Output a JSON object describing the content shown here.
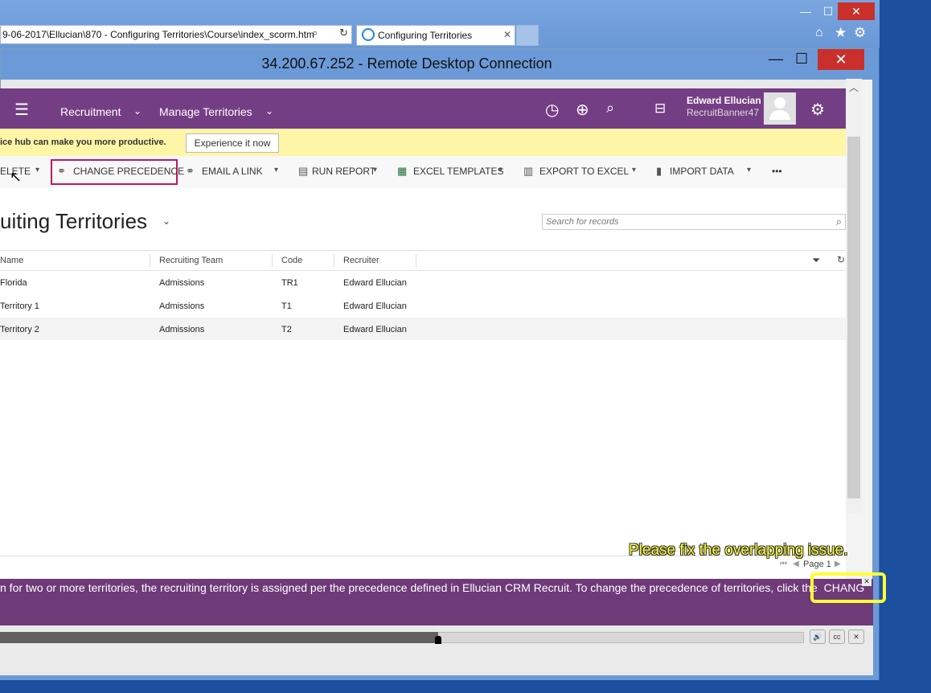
{
  "browser": {
    "address": "9-06-2017\\Ellucian\\870 - Configuring Territories\\Course\\index_scorm.htm",
    "tab_title": "Configuring Territories"
  },
  "rdp": {
    "title": "34.200.67.252 - Remote Desktop Connection"
  },
  "crm": {
    "nav": {
      "module": "Recruitment",
      "area": "Manage Territories",
      "user_name": "Edward Ellucian",
      "user_org": "RecruitBanner47"
    },
    "banner": {
      "text": "ice hub can make you more productive.",
      "button": "Experience it now"
    },
    "commands": {
      "delete": "ELETE",
      "change_precedence": "CHANGE PRECEDENCE",
      "email_link": "EMAIL A LINK",
      "run_report": "RUN REPORT",
      "excel_templates": "EXCEL TEMPLATES",
      "export_excel": "EXPORT TO EXCEL",
      "import_data": "IMPORT DATA",
      "more": "•••"
    },
    "view_title": "uiting Territories",
    "search_placeholder": "Search for records",
    "columns": [
      "Name",
      "Recruiting Team",
      "Code",
      "Recruiter"
    ],
    "rows": [
      {
        "name": "Florida",
        "team": "Admissions",
        "code": "TR1",
        "recruiter": "Edward Ellucian"
      },
      {
        "name": "Territory 1",
        "team": "Admissions",
        "code": "T1",
        "recruiter": "Edward Ellucian"
      },
      {
        "name": "Territory 2",
        "team": "Admissions",
        "code": "T2",
        "recruiter": "Edward Ellucian"
      }
    ],
    "pager": "Page 1"
  },
  "course": {
    "hint": "Please fix the overlapping issue.",
    "caption": "n for two or more territories, the recruiting territory is assigned per the precedence defined in Ellucian CRM Recruit. To change the precedence of territories, click the",
    "caption_highlight": "CHANGE",
    "progress": 0.545,
    "controls": {
      "audio": "🔊",
      "cc": "cc",
      "close": "✕"
    }
  },
  "colors": {
    "crm_purple": "#743e84",
    "highlight_box": "#c2185b",
    "hint_yellow": "#ffff33"
  }
}
